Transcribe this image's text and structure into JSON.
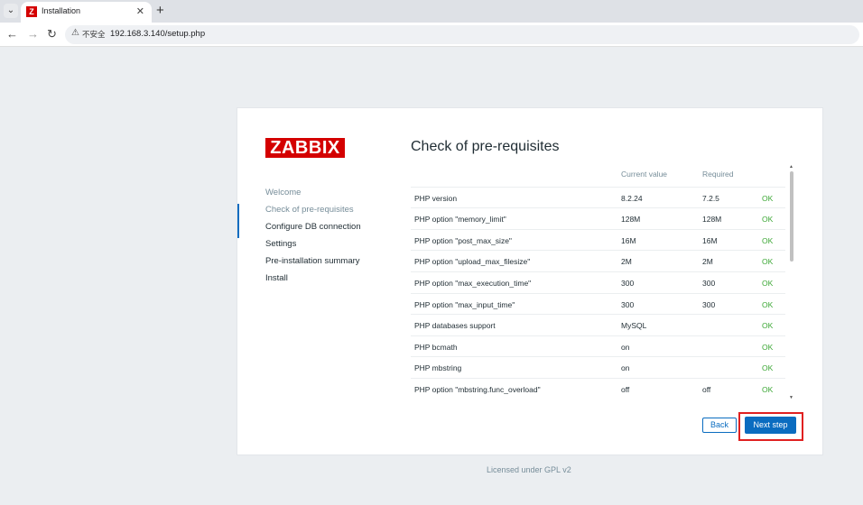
{
  "browser": {
    "tab_title": "Installation",
    "tab_favicon": "Z",
    "new_tab": "+",
    "insecure_label": "不安全",
    "url": "192.168.3.140/setup.php"
  },
  "logo": "ZABBIX",
  "steps": [
    {
      "label": "Welcome",
      "state": "done"
    },
    {
      "label": "Check of pre-requisites",
      "state": "current"
    },
    {
      "label": "Configure DB connection",
      "state": "pending"
    },
    {
      "label": "Settings",
      "state": "pending"
    },
    {
      "label": "Pre-installation summary",
      "state": "pending"
    },
    {
      "label": "Install",
      "state": "pending"
    }
  ],
  "main": {
    "heading": "Check of pre-requisites",
    "columns": [
      "",
      "Current value",
      "Required",
      ""
    ],
    "rows": [
      {
        "name": "PHP version",
        "current": "8.2.24",
        "required": "7.2.5",
        "status": "OK"
      },
      {
        "name": "PHP option \"memory_limit\"",
        "current": "128M",
        "required": "128M",
        "status": "OK"
      },
      {
        "name": "PHP option \"post_max_size\"",
        "current": "16M",
        "required": "16M",
        "status": "OK"
      },
      {
        "name": "PHP option \"upload_max_filesize\"",
        "current": "2M",
        "required": "2M",
        "status": "OK"
      },
      {
        "name": "PHP option \"max_execution_time\"",
        "current": "300",
        "required": "300",
        "status": "OK"
      },
      {
        "name": "PHP option \"max_input_time\"",
        "current": "300",
        "required": "300",
        "status": "OK"
      },
      {
        "name": "PHP databases support",
        "current": "MySQL",
        "required": "",
        "status": "OK"
      },
      {
        "name": "PHP bcmath",
        "current": "on",
        "required": "",
        "status": "OK"
      },
      {
        "name": "PHP mbstring",
        "current": "on",
        "required": "",
        "status": "OK"
      },
      {
        "name": "PHP option \"mbstring.func_overload\"",
        "current": "off",
        "required": "off",
        "status": "OK"
      }
    ],
    "back_label": "Back",
    "next_label": "Next step"
  },
  "footer": "Licensed under GPL v2",
  "colors": {
    "brand": "#d40000",
    "accent": "#0a6cc0",
    "ok": "#3da836"
  }
}
